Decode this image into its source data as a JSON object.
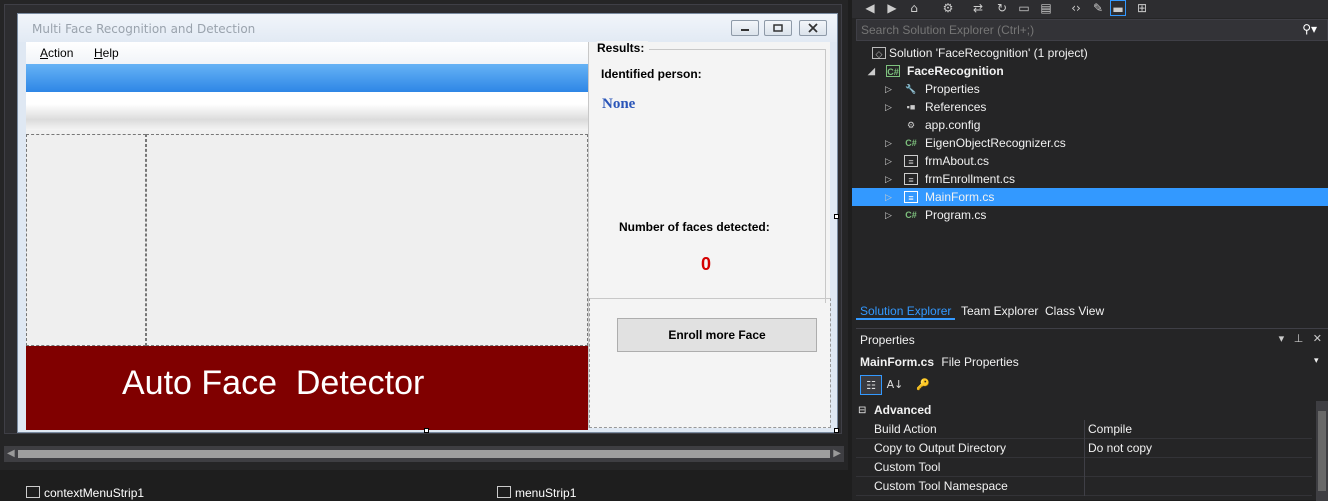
{
  "form": {
    "title": "Multi Face Recognition and Detection",
    "menu": [
      {
        "label": "Action",
        "mnemonic": "A",
        "rest": "ction"
      },
      {
        "label": "Help",
        "mnemonic": "H",
        "rest": "elp"
      }
    ],
    "banner_text": "Auto Face  Detector",
    "results": {
      "legend": "Results:",
      "identified_label": "Identified person:",
      "identified_value": "None",
      "faces_label": "Number of faces detected:",
      "faces_value": "0",
      "enroll_button": "Enroll more Face"
    }
  },
  "tray": {
    "items": [
      "contextMenuStrip1",
      "menuStrip1"
    ]
  },
  "solution_explorer": {
    "search_placeholder": "Search Solution Explorer (Ctrl+;)",
    "tree": [
      {
        "label": "Solution 'FaceRecognition' (1 project)",
        "level": 0,
        "icon": "solution-icon",
        "expander": "none"
      },
      {
        "label": "FaceRecognition",
        "level": 1,
        "icon": "csharp-project-icon",
        "expander": "expanded",
        "bold": true
      },
      {
        "label": "Properties",
        "level": 2,
        "icon": "wrench-icon",
        "expander": "collapsed"
      },
      {
        "label": "References",
        "level": 2,
        "icon": "references-icon",
        "expander": "collapsed"
      },
      {
        "label": "app.config",
        "level": 2,
        "icon": "config-file-icon",
        "expander": "none"
      },
      {
        "label": "EigenObjectRecognizer.cs",
        "level": 2,
        "icon": "csharp-file-icon",
        "expander": "collapsed"
      },
      {
        "label": "frmAbout.cs",
        "level": 2,
        "icon": "form-file-icon",
        "expander": "collapsed"
      },
      {
        "label": "frmEnrollment.cs",
        "level": 2,
        "icon": "form-file-icon",
        "expander": "collapsed"
      },
      {
        "label": "MainForm.cs",
        "level": 2,
        "icon": "form-file-icon",
        "expander": "collapsed",
        "selected": true
      },
      {
        "label": "Program.cs",
        "level": 2,
        "icon": "csharp-file-icon",
        "expander": "collapsed"
      }
    ],
    "tabs": [
      {
        "label": "Solution Explorer",
        "active": true
      },
      {
        "label": "Team Explorer",
        "active": false
      },
      {
        "label": "Class View",
        "active": false
      }
    ]
  },
  "properties": {
    "title": "Properties",
    "object_name": "MainForm.cs",
    "object_type": "File Properties",
    "category": "Advanced",
    "rows": [
      {
        "name": "Build Action",
        "value": "Compile"
      },
      {
        "name": "Copy to Output Directory",
        "value": "Do not copy"
      },
      {
        "name": "Custom Tool",
        "value": ""
      },
      {
        "name": "Custom Tool Namespace",
        "value": ""
      }
    ]
  },
  "colors": {
    "banner": "#800000",
    "identified_value": "#2a55b8",
    "faces_value": "#d40000",
    "selection": "#3399ff",
    "blue_band": "#2e86e6"
  }
}
